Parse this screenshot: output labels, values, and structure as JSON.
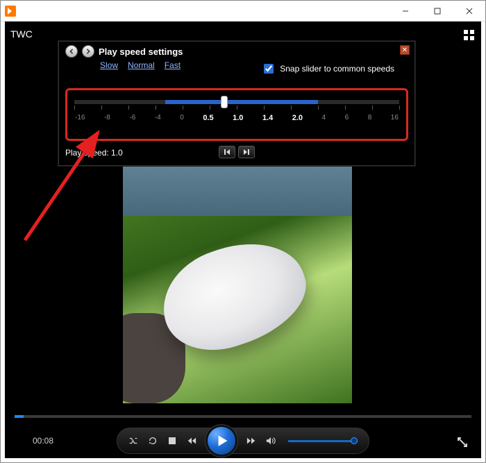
{
  "titlebar": {
    "title": ""
  },
  "header": {
    "label": "TWC"
  },
  "speed_panel": {
    "title": "Play speed settings",
    "links": {
      "slow": "Slow",
      "normal": "Normal",
      "fast": "Fast"
    },
    "snap_label": "Snap slider to common speeds",
    "snap_checked": true,
    "ticks": [
      "-16",
      "-8",
      "-6",
      "-4",
      "0",
      "0.5",
      "1.0",
      "1.4",
      "2.0",
      "4",
      "6",
      "8",
      "16"
    ],
    "bright_ticks": [
      "0.5",
      "1.0",
      "1.4",
      "2.0"
    ],
    "current_label": "Play speed: 1.0",
    "current_value": 1.0
  },
  "playback": {
    "elapsed": "00:08"
  },
  "icons": {
    "minimize": "minimize-icon",
    "maximize": "maximize-icon",
    "close": "close-icon"
  }
}
